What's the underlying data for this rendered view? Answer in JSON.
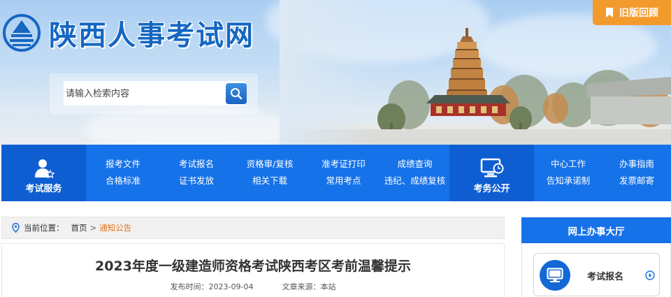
{
  "header": {
    "site_title": "陕西人事考试网",
    "search": {
      "placeholder": "请输入检索内容",
      "button_icon": "search-icon"
    },
    "old_version_label": "旧版回顾"
  },
  "nav": {
    "exam_service_label": "考试服务",
    "group1": [
      "报考文件",
      "考试报名",
      "资格审/复核",
      "准考证打印",
      "成绩查询",
      "合格标准",
      "证书发放",
      "相关下载",
      "常用考点",
      "违纪、成绩复核"
    ],
    "exam_affairs_label": "考务公开",
    "group2": [
      "中心工作",
      "办事指南",
      "告知承诺制",
      "发票邮寄"
    ]
  },
  "breadcrumb": {
    "prefix": "当前位置：",
    "home": "首页",
    "separator": ">",
    "current": "通知公告"
  },
  "article": {
    "title": "2023年度一级建造师资格考试陕西考区考前温馨提示",
    "publish_label": "发布时间：",
    "publish_date": "2023-09-04",
    "source_label": "文章来源：",
    "source": "本站"
  },
  "sidebar": {
    "heading": "网上办事大厅",
    "cards": [
      {
        "label": "考试报名",
        "icon": "monitor-icon"
      }
    ]
  },
  "colors": {
    "nav_blue": "#1672e8",
    "nav_dark_blue": "#0e5ed2",
    "accent_orange": "#f39a2d",
    "breadcrumb_current": "#e8731a",
    "title_blue": "#1567c2"
  }
}
